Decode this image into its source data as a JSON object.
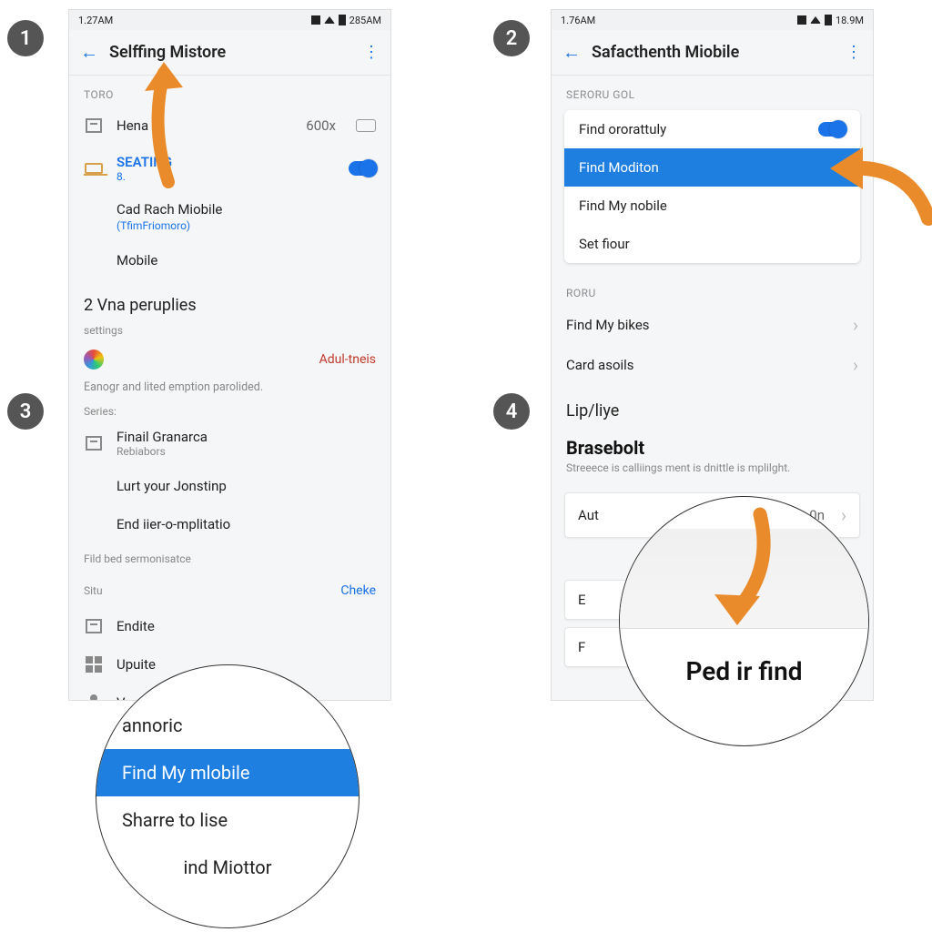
{
  "steps": {
    "s1": "1",
    "s2": "2",
    "s3": "3",
    "s4": "4"
  },
  "phone1": {
    "status": {
      "time": "1.27AM",
      "battery": "285AM"
    },
    "title": "Selffing Mistore",
    "section1": "TORO",
    "row_hena": {
      "title": "Hena",
      "value": "600x"
    },
    "row_setting": {
      "title": "SEATING",
      "sub": "8."
    },
    "cad_title": "Cad Rach Miobile",
    "cad_sub": "(TfimFriomoro)",
    "mobile": "Mobile",
    "vna": "2 Vna peruplies",
    "settings": "settings",
    "adul": "Adul-tneis",
    "desc": "Eanogr and lited emption parolided.",
    "series": "Series:",
    "finail": {
      "title": "Finail Granarca",
      "sub": "Rebiabors"
    },
    "lurt": "Lurt your Jonstinp",
    "end": "End iier-o-mplitatio",
    "fild": "Fild bed sermonisatce",
    "situ": "Situ",
    "cheke": "Cheke",
    "endite": "Endite",
    "upuite": "Upuite",
    "ve": "Ve"
  },
  "phone2": {
    "status": {
      "time": "1.76AM",
      "battery": "18.9M"
    },
    "title": "Safacthenth Miobile",
    "section1": "SERORU GOL",
    "card": {
      "i1": "Find ororattuly",
      "i2": "Find Moditon",
      "i3": "Find My nobile",
      "i4": "Set fiour"
    },
    "section2": "RORU",
    "row_bikes": "Find My bikes",
    "row_card": "Card asoils",
    "lip": "Lip/liye",
    "brasebolt": "Brasebolt",
    "brase_sub": "Streeece is calliings ment is dnittle is mplilght.",
    "aut": {
      "label": "Aut",
      "val": "0n"
    },
    "e": "E",
    "f": "F"
  },
  "zoom1": {
    "i1": "annoric",
    "i2": "Find My mlobile",
    "i3": "Sharre to lise",
    "i4": "ind Miottor"
  },
  "zoom2": {
    "big": "Ped ir find"
  }
}
